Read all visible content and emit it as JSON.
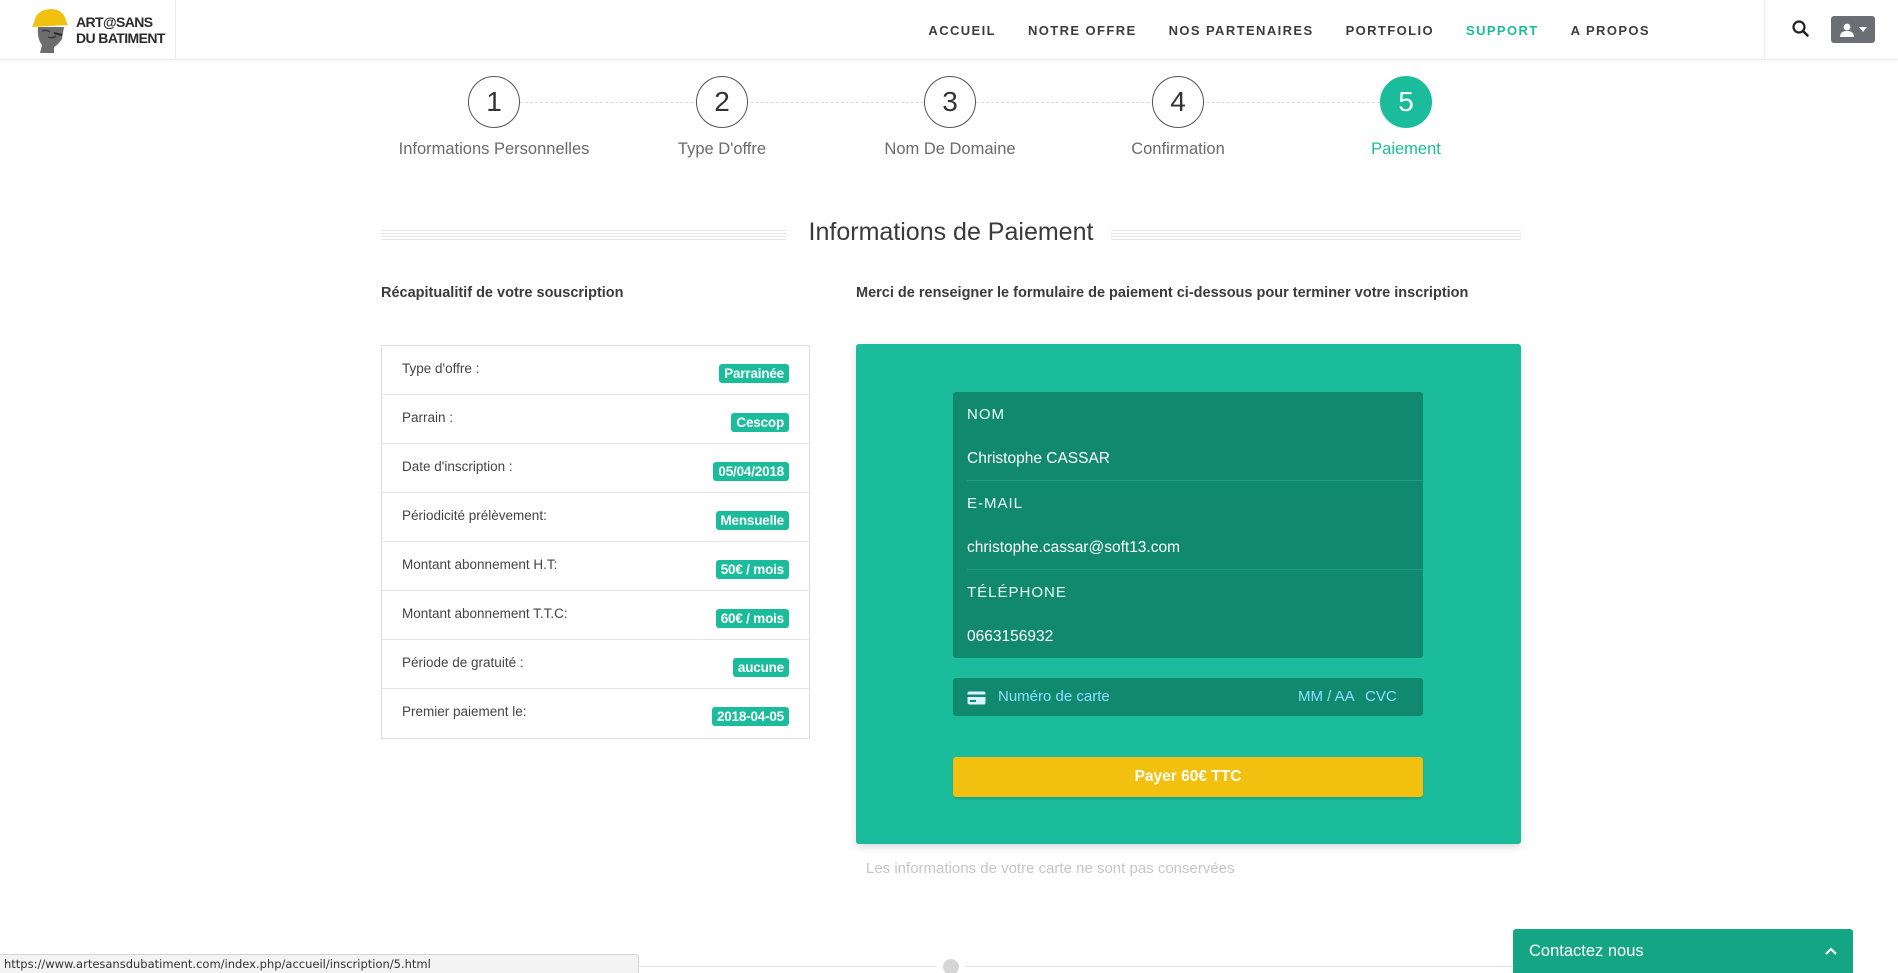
{
  "header": {
    "logo": {
      "line1": "ART@SANS",
      "line2": "DU BATIMENT"
    },
    "nav": [
      {
        "label": "ACCUEIL",
        "active": false
      },
      {
        "label": "NOTRE OFFRE",
        "active": false
      },
      {
        "label": "NOS PARTENAIRES",
        "active": false
      },
      {
        "label": "PORTFOLIO",
        "active": false
      },
      {
        "label": "SUPPORT",
        "active": true
      },
      {
        "label": "A PROPOS",
        "active": false
      }
    ],
    "icons": {
      "search": "search-icon",
      "user": "user-icon"
    }
  },
  "steps": [
    {
      "number": "1",
      "label": "Informations Personnelles",
      "active": false
    },
    {
      "number": "2",
      "label": "Type D'offre",
      "active": false
    },
    {
      "number": "3",
      "label": "Nom De Domaine",
      "active": false
    },
    {
      "number": "4",
      "label": "Confirmation",
      "active": false
    },
    {
      "number": "5",
      "label": "Paiement",
      "active": true
    }
  ],
  "section_title": "Informations de Paiement",
  "recap": {
    "title": "Récapitualitif de votre souscription",
    "rows": [
      {
        "label": "Type d'offre :",
        "value": "Parrainée"
      },
      {
        "label": "Parrain :",
        "value": "Cescop"
      },
      {
        "label": "Date d'inscription :",
        "value": "05/04/2018"
      },
      {
        "label": "Périodicité prélèvement:",
        "value": "Mensuelle"
      },
      {
        "label": "Montant abonnement H.T:",
        "value": "50€ / mois"
      },
      {
        "label": "Montant abonnement T.T.C:",
        "value": "60€ / mois"
      },
      {
        "label": "Période de gratuité :",
        "value": "aucune"
      },
      {
        "label": "Premier paiement le:",
        "value": "2018-04-05"
      }
    ]
  },
  "payment": {
    "intro": "Merci de renseigner le formulaire de paiement ci-dessous pour terminer votre inscription",
    "fields": [
      {
        "label": "NOM",
        "value": "Christophe CASSAR"
      },
      {
        "label": "E-MAIL",
        "value": "christophe.cassar@soft13.com"
      },
      {
        "label": "TÉLÉPHONE",
        "value": "0663156932"
      }
    ],
    "card": {
      "number_placeholder": "Numéro de carte",
      "date_placeholder": "MM / AA",
      "cvc_placeholder": "CVC"
    },
    "pay_button": "Payer 60€ TTC",
    "disclaimer": "Les informations de votre carte ne sont pas conservées"
  },
  "status_url": "https://www.artesansdubatiment.com/index.php/accueil/inscription/5.html",
  "contact": {
    "label": "Contactez nous"
  },
  "colors": {
    "accent": "#1bbc9b",
    "accent_dark": "#10896e",
    "button": "#f2c10f",
    "contact_bg": "#14a585"
  }
}
